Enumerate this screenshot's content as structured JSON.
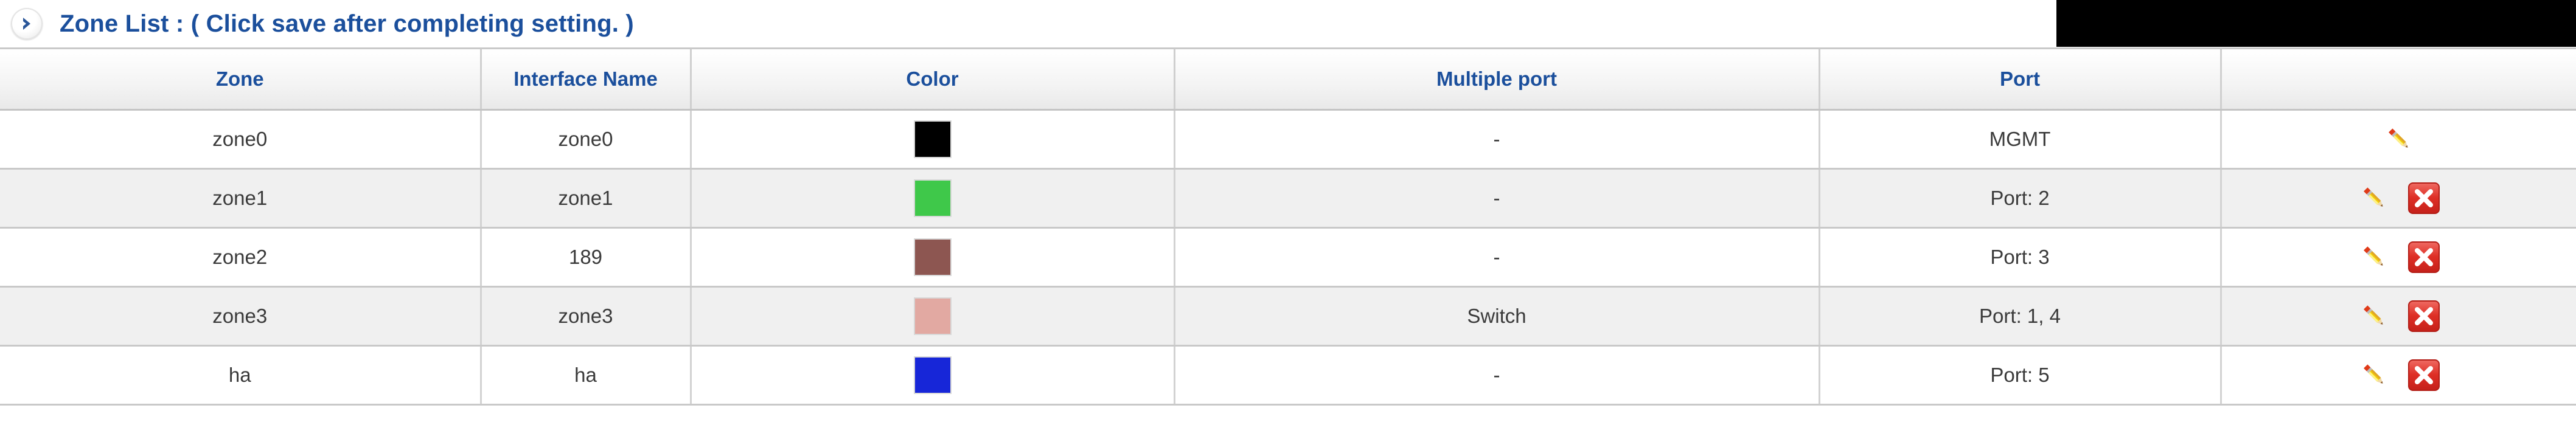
{
  "header": {
    "expand_icon": "chevron-right-circle-icon",
    "title_main": "Zone List : ",
    "title_note": "( Click save after completing setting. )",
    "title_color": "#1b4f9c"
  },
  "table": {
    "columns": [
      {
        "key": "zone",
        "label": "Zone"
      },
      {
        "key": "interface_name",
        "label": "Interface Name"
      },
      {
        "key": "color",
        "label": "Color"
      },
      {
        "key": "multiple_port",
        "label": "Multiple port"
      },
      {
        "key": "port",
        "label": "Port"
      },
      {
        "key": "actions",
        "label": ""
      }
    ],
    "rows": [
      {
        "zone": "zone0",
        "interface_name": "zone0",
        "color": "#000000",
        "color_name": "black",
        "multiple_port": "-",
        "port": "MGMT",
        "edit_icon": "pencil-icon",
        "delete_icon": null
      },
      {
        "zone": "zone1",
        "interface_name": "zone1",
        "color": "#3fc84a",
        "color_name": "green",
        "multiple_port": "-",
        "port": "Port: 2",
        "edit_icon": "pencil-icon",
        "delete_icon": "delete-icon"
      },
      {
        "zone": "zone2",
        "interface_name": "189",
        "color": "#8d5651",
        "color_name": "brown",
        "multiple_port": "-",
        "port": "Port: 3",
        "edit_icon": "pencil-icon",
        "delete_icon": "delete-icon"
      },
      {
        "zone": "zone3",
        "interface_name": "zone3",
        "color": "#e2a9a2",
        "color_name": "pink",
        "multiple_port": "Switch",
        "port": "Port: 1, 4",
        "edit_icon": "pencil-icon",
        "delete_icon": "delete-icon"
      },
      {
        "zone": "ha",
        "interface_name": "ha",
        "color": "#1726d8",
        "color_name": "blue",
        "multiple_port": "-",
        "port": "Port: 5",
        "edit_icon": "pencil-icon",
        "delete_icon": "delete-icon"
      }
    ]
  }
}
